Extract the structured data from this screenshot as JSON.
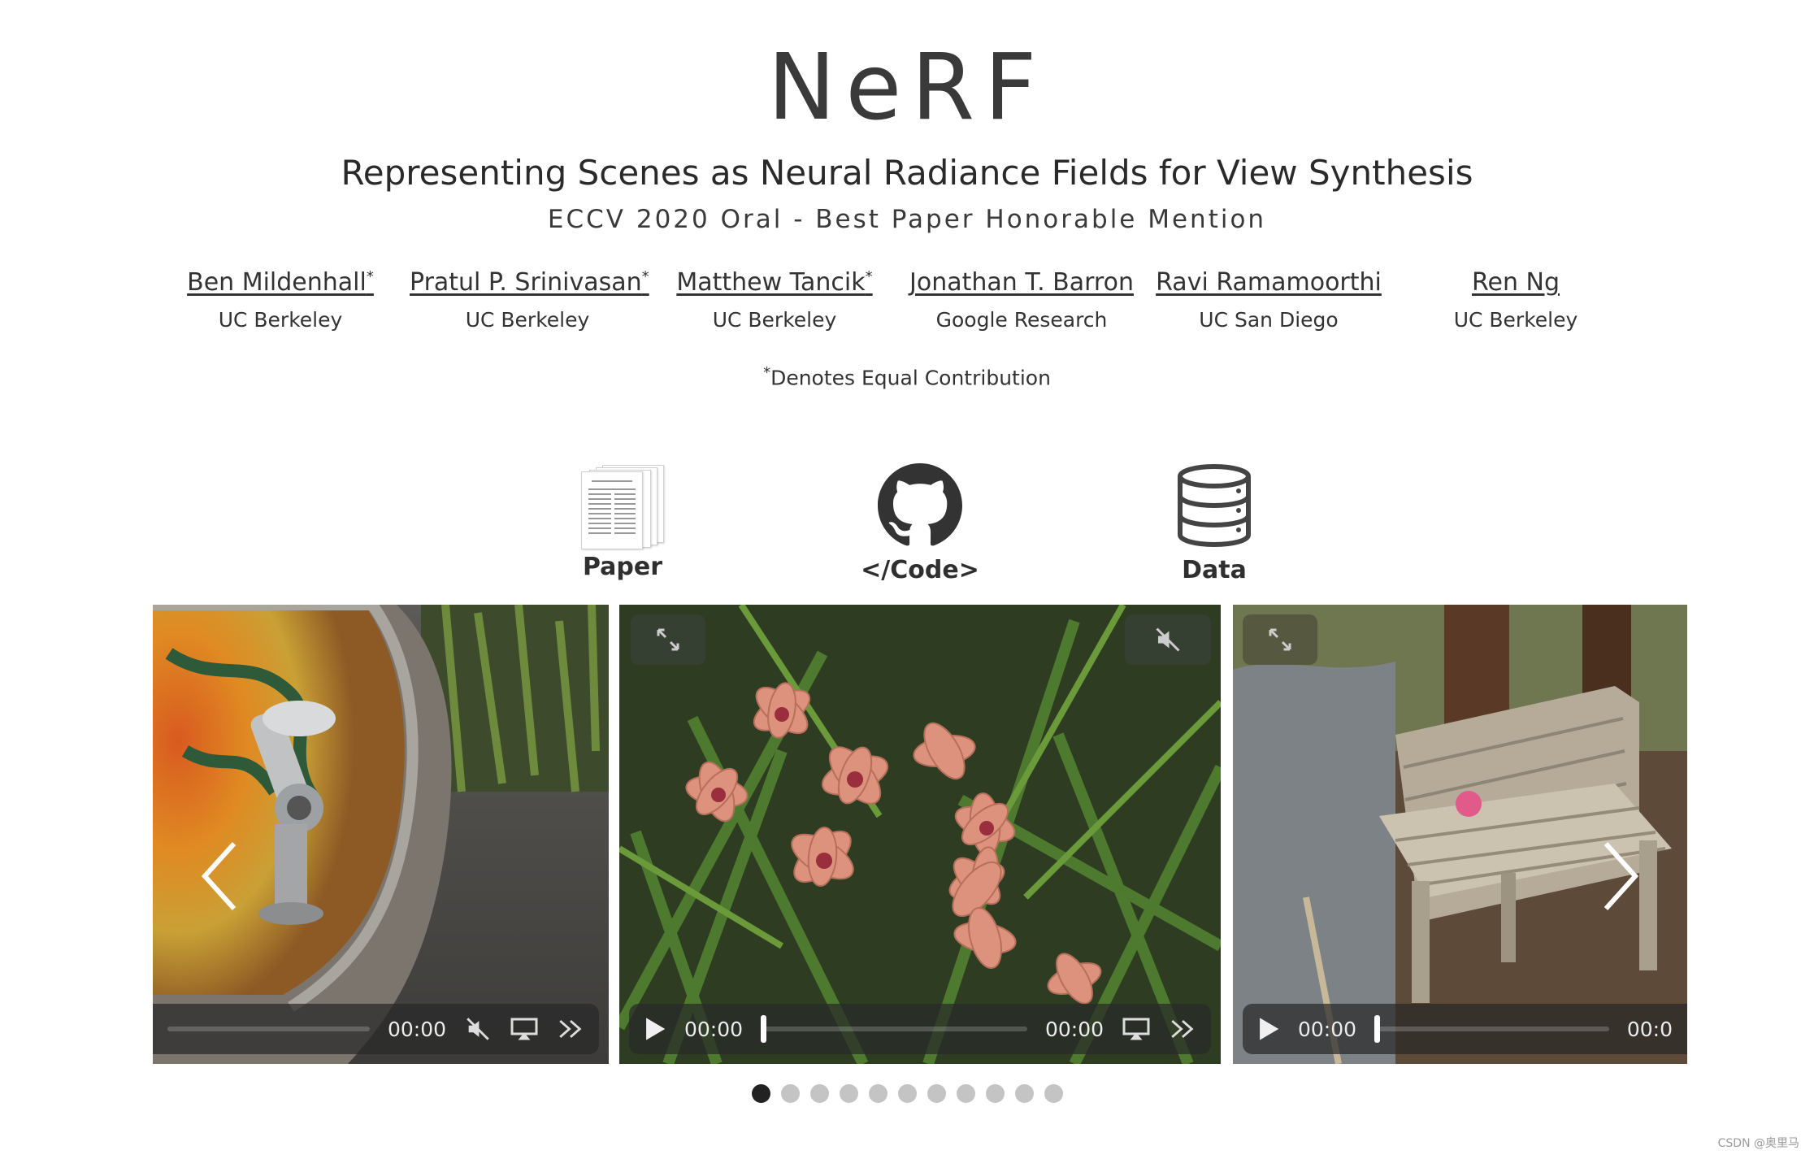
{
  "header": {
    "title": "NeRF",
    "subtitle": "Representing Scenes as Neural Radiance Fields for View Synthesis",
    "venue": "ECCV 2020 Oral - Best Paper Honorable Mention"
  },
  "authors": [
    {
      "name": "Ben Mildenhall",
      "mark": "*",
      "affiliation": "UC Berkeley"
    },
    {
      "name": "Pratul P. Srinivasan",
      "mark": "*",
      "affiliation": "UC Berkeley"
    },
    {
      "name": "Matthew Tancik",
      "mark": "*",
      "affiliation": "UC Berkeley"
    },
    {
      "name": "Jonathan T. Barron",
      "mark": "",
      "affiliation": "Google Research"
    },
    {
      "name": "Ravi Ramamoorthi",
      "mark": "",
      "affiliation": "UC San Diego"
    },
    {
      "name": "Ren Ng",
      "mark": "",
      "affiliation": "UC Berkeley"
    }
  ],
  "equal_note": {
    "mark": "*",
    "text": "Denotes Equal Contribution"
  },
  "links": {
    "paper": {
      "label": "Paper",
      "icon": "paper-thumbnail-icon"
    },
    "code": {
      "label": "</Code>",
      "icon": "github-icon"
    },
    "data": {
      "label": "Data",
      "icon": "database-icon"
    }
  },
  "carousel": {
    "slides": [
      {
        "scene": "drinking fountain with mosaic",
        "current_time": "00:00",
        "duration": "00:00"
      },
      {
        "scene": "orchid flowers",
        "current_time": "00:00",
        "duration": "00:00"
      },
      {
        "scene": "wooden bench",
        "current_time": "00:00",
        "duration": "00:0"
      }
    ],
    "dot_count": 11,
    "active_dot": 0
  },
  "watermark": "CSDN @奥里马",
  "colors": {
    "text": "#2b2b2b",
    "control_bar": "#282828",
    "dot_inactive": "#c4c4c4",
    "dot_active": "#222222"
  }
}
